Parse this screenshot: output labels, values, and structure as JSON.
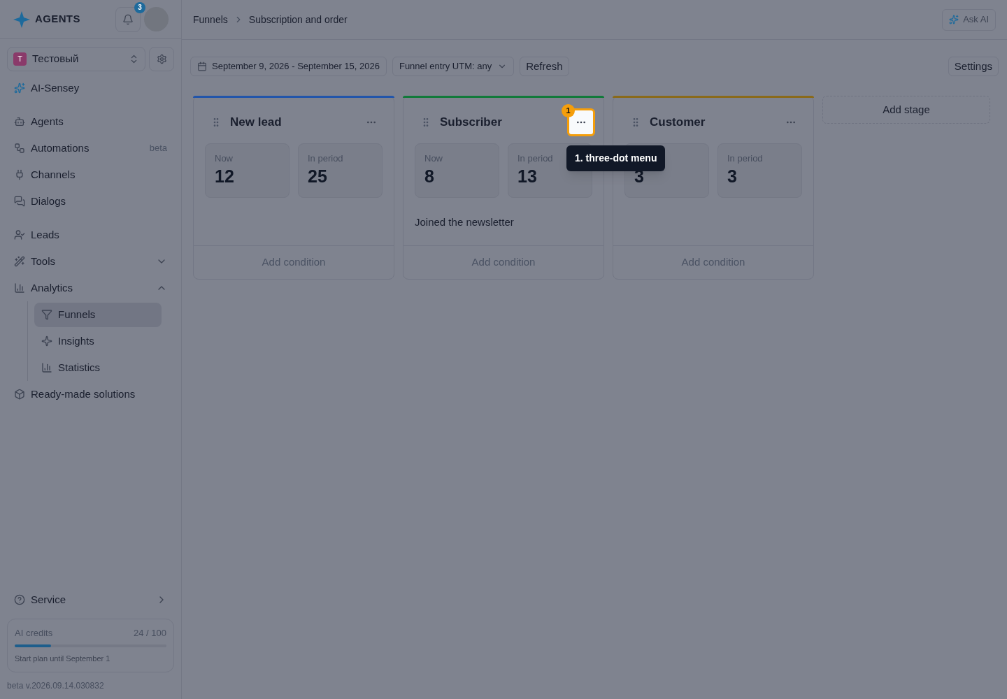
{
  "logo": {
    "text": "AGENTS"
  },
  "notifications": {
    "count": "3"
  },
  "workspace": {
    "initial": "T",
    "name": "Тестовый"
  },
  "sidebar": {
    "sections": [
      {
        "items": [
          {
            "label": "AI-Sensey"
          }
        ]
      },
      {
        "items": [
          {
            "label": "Agents"
          },
          {
            "label": "Automations",
            "badge": "beta"
          },
          {
            "label": "Channels"
          },
          {
            "label": "Dialogs"
          }
        ]
      },
      {
        "items": [
          {
            "label": "Leads"
          },
          {
            "label": "Tools",
            "expanded": false
          },
          {
            "label": "Analytics",
            "expanded": true,
            "children": [
              {
                "label": "Funnels",
                "selected": true
              },
              {
                "label": "Insights",
                "selected": false
              },
              {
                "label": "Statistics",
                "selected": false
              }
            ]
          },
          {
            "label": "Ready-made solutions"
          }
        ]
      }
    ]
  },
  "service": {
    "label": "Service"
  },
  "credits": {
    "label": "AI credits",
    "reading": "24 / 100",
    "level": 0.24,
    "note": "Start plan until September 1"
  },
  "version": "beta v.2026.09.14.030832",
  "breadcrumb": [
    "Funnels",
    "Subscription and order"
  ],
  "ask_ai": "Ask AI",
  "toolbar": {
    "date_range": "September 9, 2026 - September 15, 2026",
    "utm_filter": "Funnel entry UTM: any",
    "refresh": "Refresh",
    "settings": "Settings"
  },
  "stages": [
    {
      "title": "New lead",
      "color": "#2255aa",
      "now_label": "Now",
      "now": "12",
      "period_label": "In period",
      "period": "25",
      "add_condition": "Add condition",
      "highlighted": false
    },
    {
      "title": "Subscriber",
      "color": "#117a3a",
      "now_label": "Now",
      "now": "8",
      "period_label": "In period",
      "period": "13",
      "conditions": [
        "Joined the newsletter"
      ],
      "add_condition": "Add condition",
      "highlighted": true
    },
    {
      "title": "Customer",
      "color": "#8a6a1a",
      "now": "3",
      "period_label": "In period",
      "period": "3",
      "add_condition": "Add condition",
      "highlighted": false
    }
  ],
  "add_stage": "Add stage",
  "callout": {
    "number": "1",
    "label": "1. three-dot menu"
  }
}
